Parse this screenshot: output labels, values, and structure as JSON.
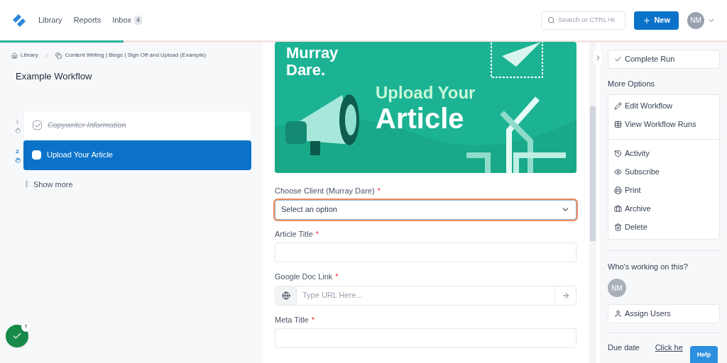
{
  "nav": {
    "items": [
      {
        "label": "Library"
      },
      {
        "label": "Reports"
      },
      {
        "label": "Inbox",
        "badge": "4"
      }
    ],
    "search": {
      "placeholder": "Search or CTRL+K"
    },
    "new_button": "New",
    "avatar": "NM"
  },
  "progress": {
    "level": 0.17
  },
  "breadcrumb": [
    "Library",
    "Content Writing | Blogs | Sign Off and Upload (Example)"
  ],
  "workflow_title": "Example Workflow",
  "tasks": [
    {
      "number": "1",
      "label": "Copywriter Information",
      "checked": true,
      "selected": false
    },
    {
      "number": "2",
      "label": "Upload Your Article",
      "checked": false,
      "selected": true
    }
  ],
  "show_more": "Show more",
  "banner": {
    "line1": "Murray",
    "line2": "Dare.",
    "heading1": "Upload Your",
    "heading2": "Article"
  },
  "required_mark": "*",
  "form": [
    {
      "kind": "select",
      "label": "Choose Client (Murray Dare)",
      "required": true,
      "focused": true,
      "value": "Select an option"
    },
    {
      "kind": "text",
      "label": "Article Title",
      "required": true,
      "focused": false
    },
    {
      "kind": "url",
      "label": "Google Doc Link",
      "required": true,
      "focused": false,
      "placeholder": "Type URL Here..."
    },
    {
      "kind": "text",
      "label": "Meta Title",
      "required": true,
      "focused": false
    }
  ],
  "sidebar": {
    "complete": "Complete Run",
    "more_options": "More Options",
    "options": [
      {
        "kind": "edit",
        "label": "Edit Workflow"
      },
      {
        "kind": "runs",
        "label": "View Workflow Runs"
      },
      {
        "kind": "divider"
      },
      {
        "kind": "activity",
        "label": "Activity"
      },
      {
        "kind": "subscribe",
        "label": "Subscribe"
      },
      {
        "kind": "print",
        "label": "Print"
      },
      {
        "kind": "archive",
        "label": "Archive"
      },
      {
        "kind": "delete",
        "label": "Delete"
      }
    ],
    "working_title": "Who's working on this?",
    "working_avatar": "NM",
    "assign": "Assign Users",
    "due_label": "Due date",
    "due_link": "Click he"
  },
  "help": "Help",
  "checklist_badge": "7"
}
